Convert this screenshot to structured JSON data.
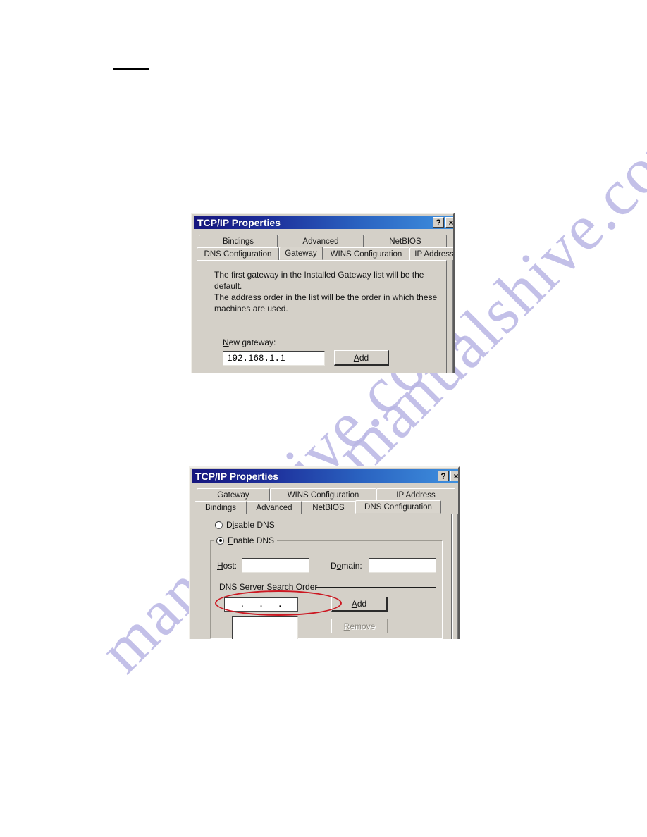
{
  "page": {
    "background": "#ffffff",
    "watermark_text": "manualshive.com",
    "watermark_color": "#b9b6e4",
    "annotation_color": "#cc1822"
  },
  "dialog_gateway": {
    "title": "TCP/IP Properties",
    "titlebar_buttons": [
      {
        "name": "help-button",
        "label": "?"
      },
      {
        "name": "close-button",
        "label": "×"
      }
    ],
    "tabs_row_top": [
      {
        "label": "Bindings",
        "selected": false
      },
      {
        "label": "Advanced",
        "selected": false
      },
      {
        "label": "NetBIOS",
        "selected": false
      }
    ],
    "tabs_row_bottom": [
      {
        "label": "DNS Configuration",
        "selected": false
      },
      {
        "label": "Gateway",
        "selected": true
      },
      {
        "label": "WINS Configuration",
        "selected": false
      },
      {
        "label": "IP Address",
        "selected": false
      }
    ],
    "description": "The first gateway in the Installed Gateway list will be the default.\nThe address order in the list will be the order in which these\nmachines are used.",
    "new_gateway": {
      "label_prefix": "N",
      "label_rest": "ew gateway:",
      "value": "192.168.1.1",
      "placeholder": ""
    },
    "add_button": {
      "prefix": "A",
      "rest": "dd"
    }
  },
  "dialog_dns": {
    "title": "TCP/IP Properties",
    "titlebar_buttons": [
      {
        "name": "help-button",
        "label": "?"
      },
      {
        "name": "close-button",
        "label": "×"
      }
    ],
    "tabs_row_top": [
      {
        "label": "Gateway",
        "selected": false
      },
      {
        "label": "WINS Configuration",
        "selected": false
      },
      {
        "label": "IP Address",
        "selected": false
      }
    ],
    "tabs_row_bottom": [
      {
        "label": "Bindings",
        "selected": false
      },
      {
        "label": "Advanced",
        "selected": false
      },
      {
        "label": "NetBIOS",
        "selected": false
      },
      {
        "label": "DNS Configuration",
        "selected": true
      }
    ],
    "radio_disable": {
      "prefix": "D",
      "mid": "i",
      "rest": "sable DNS",
      "selected": false
    },
    "radio_enable": {
      "prefix": "E",
      "rest": "nable DNS",
      "selected": true
    },
    "host": {
      "label_prefix": "H",
      "label_rest": "ost:",
      "value": "",
      "placeholder": ""
    },
    "domain": {
      "label_prefix": "D",
      "label_mid": "o",
      "label_rest": "main:",
      "value": "",
      "placeholder": ""
    },
    "search_order_label": "DNS Server Search Order",
    "dns_ip": {
      "octets": [
        "",
        "",
        "",
        ""
      ],
      "separator": "."
    },
    "add_button": {
      "prefix": "A",
      "rest": "dd",
      "disabled": false
    },
    "remove_button": {
      "prefix": "R",
      "rest": "emove",
      "disabled": true
    },
    "server_list": {
      "items": []
    }
  }
}
